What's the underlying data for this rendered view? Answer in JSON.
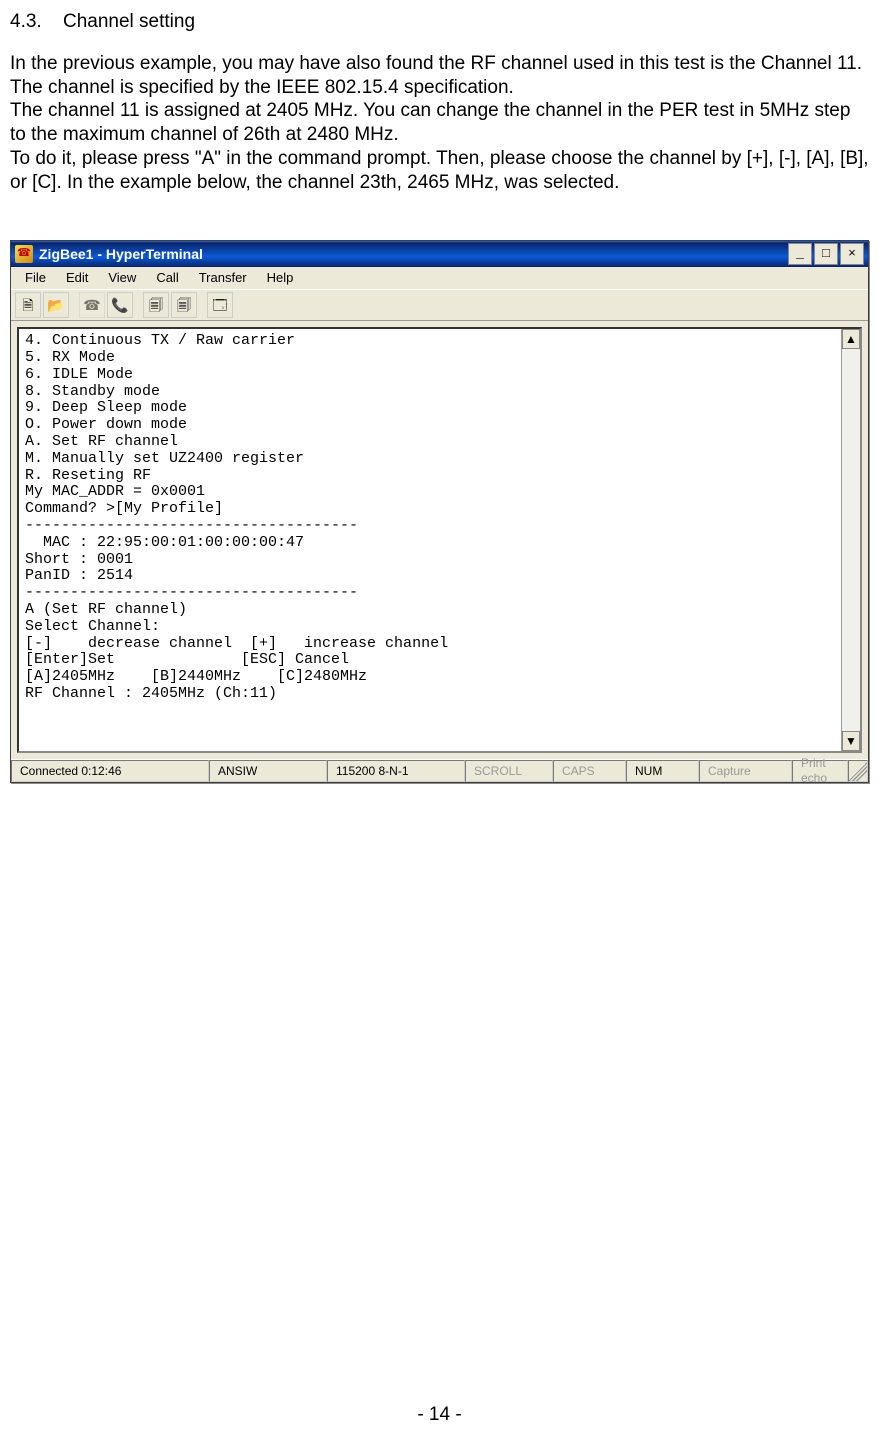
{
  "section": {
    "number": "4.3.",
    "title": "Channel setting"
  },
  "paragraphs": [
    "In the previous example, you may have also found the RF channel used in this test is the Channel 11. The channel is specified by the IEEE 802.15.4 specification.",
    "The channel 11 is assigned at 2405 MHz. You can change the channel in the PER test in 5MHz step to the maximum channel of 26th at 2480 MHz.",
    "To do it, please press \"A\" in the command prompt. Then, please choose the channel by [+], [-], [A], [B], or [C]. In the example below, the channel 23th, 2465 MHz, was selected."
  ],
  "window": {
    "title": "ZigBee1 - HyperTerminal",
    "menus": [
      "File",
      "Edit",
      "View",
      "Call",
      "Transfer",
      "Help"
    ],
    "toolbar_icons": [
      "new-doc-icon",
      "open-icon",
      "phone-icon",
      "hangup-icon",
      "send-icon",
      "receive-icon",
      "properties-icon"
    ],
    "controls": {
      "min": "_",
      "max": "□",
      "close": "×"
    }
  },
  "terminal_lines": [
    "4. Continuous TX / Raw carrier",
    "5. RX Mode",
    "6. IDLE Mode",
    "8. Standby mode",
    "9. Deep Sleep mode",
    "O. Power down mode",
    "A. Set RF channel",
    "M. Manually set UZ2400 register",
    "R. Reseting RF",
    "My MAC_ADDR = 0x0001",
    "Command? >[My Profile]",
    "-------------------------------------",
    "  MAC : 22:95:00:01:00:00:00:47",
    "Short : 0001",
    "PanID : 2514",
    "-------------------------------------",
    "A (Set RF channel)",
    "",
    "Select Channel:",
    "[-]    decrease channel  [+]   increase channel",
    "[Enter]Set              [ESC] Cancel",
    "[A]2405MHz    [B]2440MHz    [C]2480MHz",
    "",
    "RF Channel : 2405MHz (Ch:11)"
  ],
  "status": {
    "conn": "Connected 0:12:46",
    "emu": "ANSIW",
    "port": "115200 8-N-1",
    "scroll": "SCROLL",
    "caps": "CAPS",
    "num": "NUM",
    "capture": "Capture",
    "echo": "Print echo"
  },
  "footer": "- 14 -"
}
